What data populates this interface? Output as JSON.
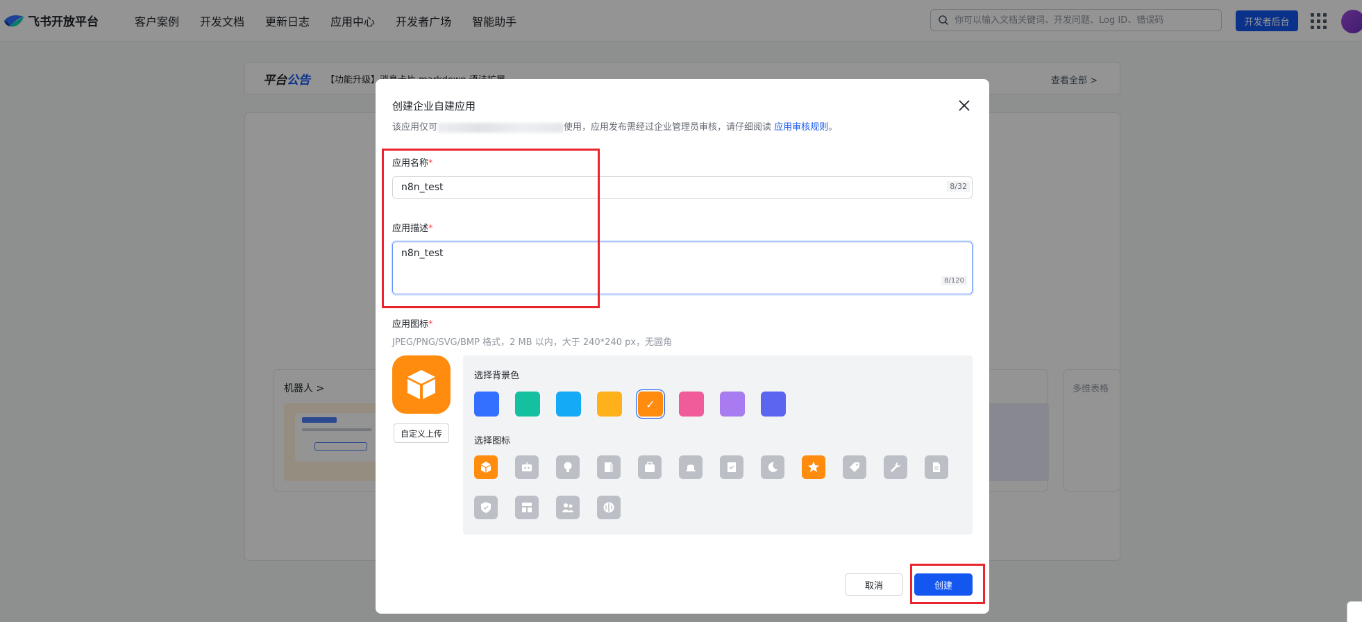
{
  "brand": {
    "name": "飞书开放平台"
  },
  "nav": [
    "客户案例",
    "开发文档",
    "更新日志",
    "应用中心",
    "开发者广场",
    "智能助手"
  ],
  "search": {
    "placeholder": "你可以输入文档关键词、开发问题、Log ID、错误码"
  },
  "header_button": "开发者后台",
  "notice": {
    "title_prefix": "平台",
    "title_accent": "公告",
    "text": "【功能升级】消息卡片 markdown 语法扩展",
    "more": "查看全部 >"
  },
  "background_cards": {
    "bot_title": "机器人 >",
    "right_title": "多维表格"
  },
  "modal": {
    "title": "创建企业自建应用",
    "desc_prefix": "该应用仅可",
    "desc_suffix": "使用，应用发布需经过企业管理员审核，请仔细阅读",
    "desc_link": "应用审核规则",
    "desc_end": "。",
    "name_label": "应用名称",
    "name_value": "n8n_test",
    "name_count": "8/32",
    "desc_label": "应用描述",
    "desc_value": "n8n_test",
    "desc_count": "8/120",
    "icon_label": "应用图标",
    "icon_hint": "JPEG/PNG/SVG/BMP 格式，2 MB 以内，大于 240*240 px，无圆角",
    "upload_label": "自定义上传",
    "bg_color_label": "选择背景色",
    "icon_picker_label": "选择图标",
    "bg_colors": [
      "#3370ff",
      "#14c0a0",
      "#14aaf5",
      "#ffb11b",
      "#ff8c0f",
      "#ef5c99",
      "#a87cf0",
      "#5b65f0"
    ],
    "selected_bg_color": "#ff8c0f",
    "icons": [
      "cube-icon",
      "robot-icon",
      "bulb-icon",
      "document-icon",
      "briefcase-icon",
      "bell-icon",
      "checklist-icon",
      "moon-icon",
      "star-icon",
      "tag-icon",
      "wrench-icon",
      "file-icon",
      "shield-icon",
      "layout-icon",
      "team-icon",
      "compass-icon"
    ],
    "selected_icon": "star-icon",
    "cancel": "取消",
    "create": "创建"
  }
}
